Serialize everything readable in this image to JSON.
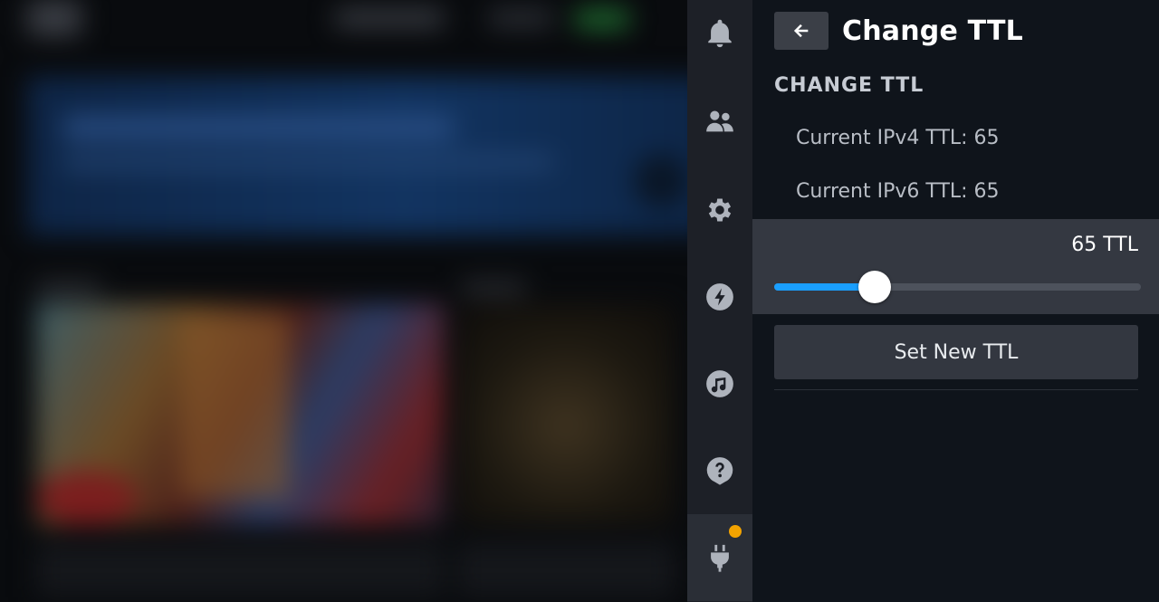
{
  "rail": {
    "items": [
      {
        "name": "notifications",
        "icon": "bell-icon"
      },
      {
        "name": "friends",
        "icon": "friends-icon"
      },
      {
        "name": "settings",
        "icon": "gear-icon"
      },
      {
        "name": "performance",
        "icon": "lightning-icon"
      },
      {
        "name": "music",
        "icon": "music-note-icon"
      },
      {
        "name": "help",
        "icon": "help-icon"
      },
      {
        "name": "plugins",
        "icon": "plug-icon",
        "active": true,
        "badge": true
      }
    ],
    "badge_color": "#f3a300"
  },
  "panel": {
    "title": "Change TTL",
    "back_icon": "arrow-left-icon",
    "section_label": "CHANGE TTL",
    "ipv4_text": "Current IPv4 TTL: 65",
    "ipv6_text": "Current IPv6 TTL: 65",
    "slider": {
      "value_label": "65 TTL",
      "fill_fraction": 0.274,
      "accent": "#1a9fff"
    },
    "set_button_label": "Set New TTL"
  }
}
